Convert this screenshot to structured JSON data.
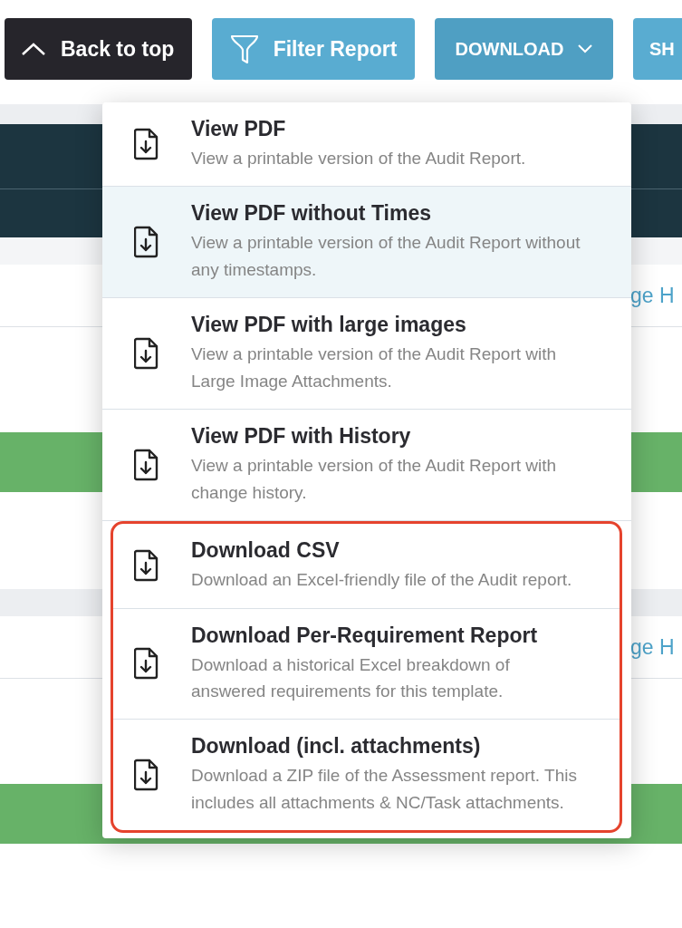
{
  "toolbar": {
    "buttons": [
      {
        "kind": "back",
        "label": "Back to top"
      },
      {
        "kind": "filter",
        "label": "Filter Report"
      },
      {
        "kind": "dropdown",
        "label": "DOWNLOAD",
        "expanded": true
      },
      {
        "kind": "plain",
        "label": "SH"
      }
    ]
  },
  "background": {
    "links": [
      "ge H",
      "ge H"
    ]
  },
  "download_menu": {
    "items": [
      {
        "title": "View PDF",
        "description": "View a printable version of the Audit Report.",
        "highlighted": false
      },
      {
        "title": "View PDF without Times",
        "description": "View a printable version of the Audit Report without any timestamps.",
        "highlighted": true
      },
      {
        "title": "View PDF with large images",
        "description": "View a printable version of the Audit Report with Large Image Attachments.",
        "highlighted": false
      },
      {
        "title": "View PDF with History",
        "description": "View a printable version of the Audit Report with change history.",
        "highlighted": false
      }
    ],
    "outlined_items": {
      "color": "#e5432d",
      "items": [
        {
          "title": "Download CSV",
          "description": "Download an Excel-friendly file of the Audit report.",
          "highlighted": false
        },
        {
          "title": "Download Per-Requirement Report",
          "description": "Download a historical Excel breakdown of answered requirements for this template.",
          "highlighted": false
        },
        {
          "title": "Download (incl. attachments)",
          "description": "Download a ZIP file of the Assessment report. This includes all attachments & NC/Task attachments.",
          "highlighted": false
        }
      ]
    }
  }
}
